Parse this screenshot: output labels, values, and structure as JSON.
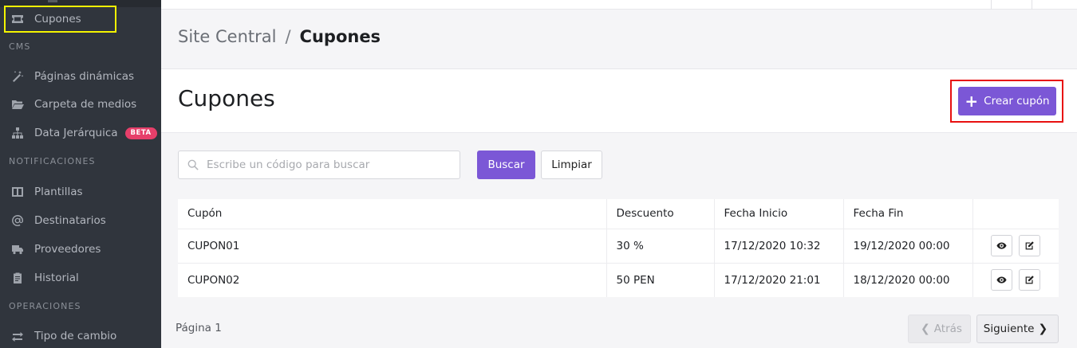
{
  "sidebar": {
    "items": [
      {
        "label": "Cupones",
        "icon": "ticket-icon"
      },
      {
        "label": "Páginas dinámicas",
        "icon": "magic-wand-icon"
      },
      {
        "label": "Carpeta de medios",
        "icon": "folder-open-icon"
      },
      {
        "label": "Data Jerárquica",
        "icon": "sitemap-icon",
        "badge": "BETA"
      },
      {
        "label": "Plantillas",
        "icon": "columns-icon"
      },
      {
        "label": "Destinatarios",
        "icon": "at-sign-icon"
      },
      {
        "label": "Proveedores",
        "icon": "truck-icon"
      },
      {
        "label": "Historial",
        "icon": "clipboard-icon"
      },
      {
        "label": "Tipo de cambio",
        "icon": "exchange-icon"
      }
    ],
    "sections": {
      "cms": "CMS",
      "notificaciones": "NOTIFICACIONES",
      "operaciones": "OPERACIONES"
    }
  },
  "breadcrumb": {
    "root": "Site Central",
    "separator": "/",
    "current": "Cupones"
  },
  "header": {
    "title": "Cupones",
    "create_button": "Crear cupón"
  },
  "search": {
    "placeholder": "Escribe un código para buscar",
    "value": "",
    "search_button": "Buscar",
    "clear_button": "Limpiar"
  },
  "table": {
    "columns": [
      "Cupón",
      "Descuento",
      "Fecha Inicio",
      "Fecha Fin",
      ""
    ],
    "rows": [
      {
        "coupon": "CUPON01",
        "discount": "30 %",
        "start": "17/12/2020 10:32",
        "end": "19/12/2020 00:00"
      },
      {
        "coupon": "CUPON02",
        "discount": "50 PEN",
        "start": "17/12/2020 21:01",
        "end": "18/12/2020 00:00"
      }
    ]
  },
  "pagination": {
    "page_label": "Página 1",
    "prev": "Atrás",
    "next": "Siguiente"
  },
  "colors": {
    "primary": "#7b57d6",
    "sidebar_bg": "#30353d",
    "badge": "#e63f6a",
    "highlight_yellow": "#f4f400",
    "highlight_red": "#e81010"
  }
}
